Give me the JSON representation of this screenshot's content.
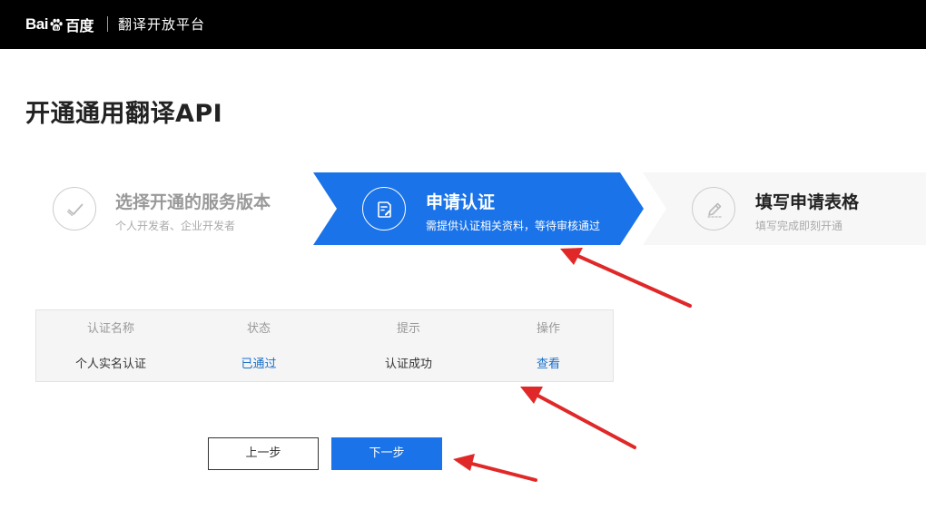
{
  "header": {
    "logo_text_left": "Bai",
    "logo_text_right": "百度",
    "platform_name": "翻译开放平台"
  },
  "page": {
    "title": "开通通用翻译API"
  },
  "steps": [
    {
      "title": "选择开通的服务版本",
      "subtitle": "个人开发者、企业开发者",
      "icon": "check-icon",
      "state": "done"
    },
    {
      "title": "申请认证",
      "subtitle": "需提供认证相关资料，等待审核通过",
      "icon": "edit-document-icon",
      "state": "active"
    },
    {
      "title": "填写申请表格",
      "subtitle": "填写完成即刻开通",
      "icon": "pencil-icon",
      "state": "pending"
    }
  ],
  "table": {
    "columns": [
      "认证名称",
      "状态",
      "提示",
      "操作"
    ],
    "rows": [
      {
        "name": "个人实名认证",
        "status": "已通过",
        "hint": "认证成功",
        "action": "查看"
      }
    ]
  },
  "buttons": {
    "prev_label": "上一步",
    "next_label": "下一步"
  },
  "colors": {
    "topbar": "#000000",
    "accent": "#1a73e8",
    "link": "#1a6fc9",
    "annotation_arrow": "#e02828"
  }
}
